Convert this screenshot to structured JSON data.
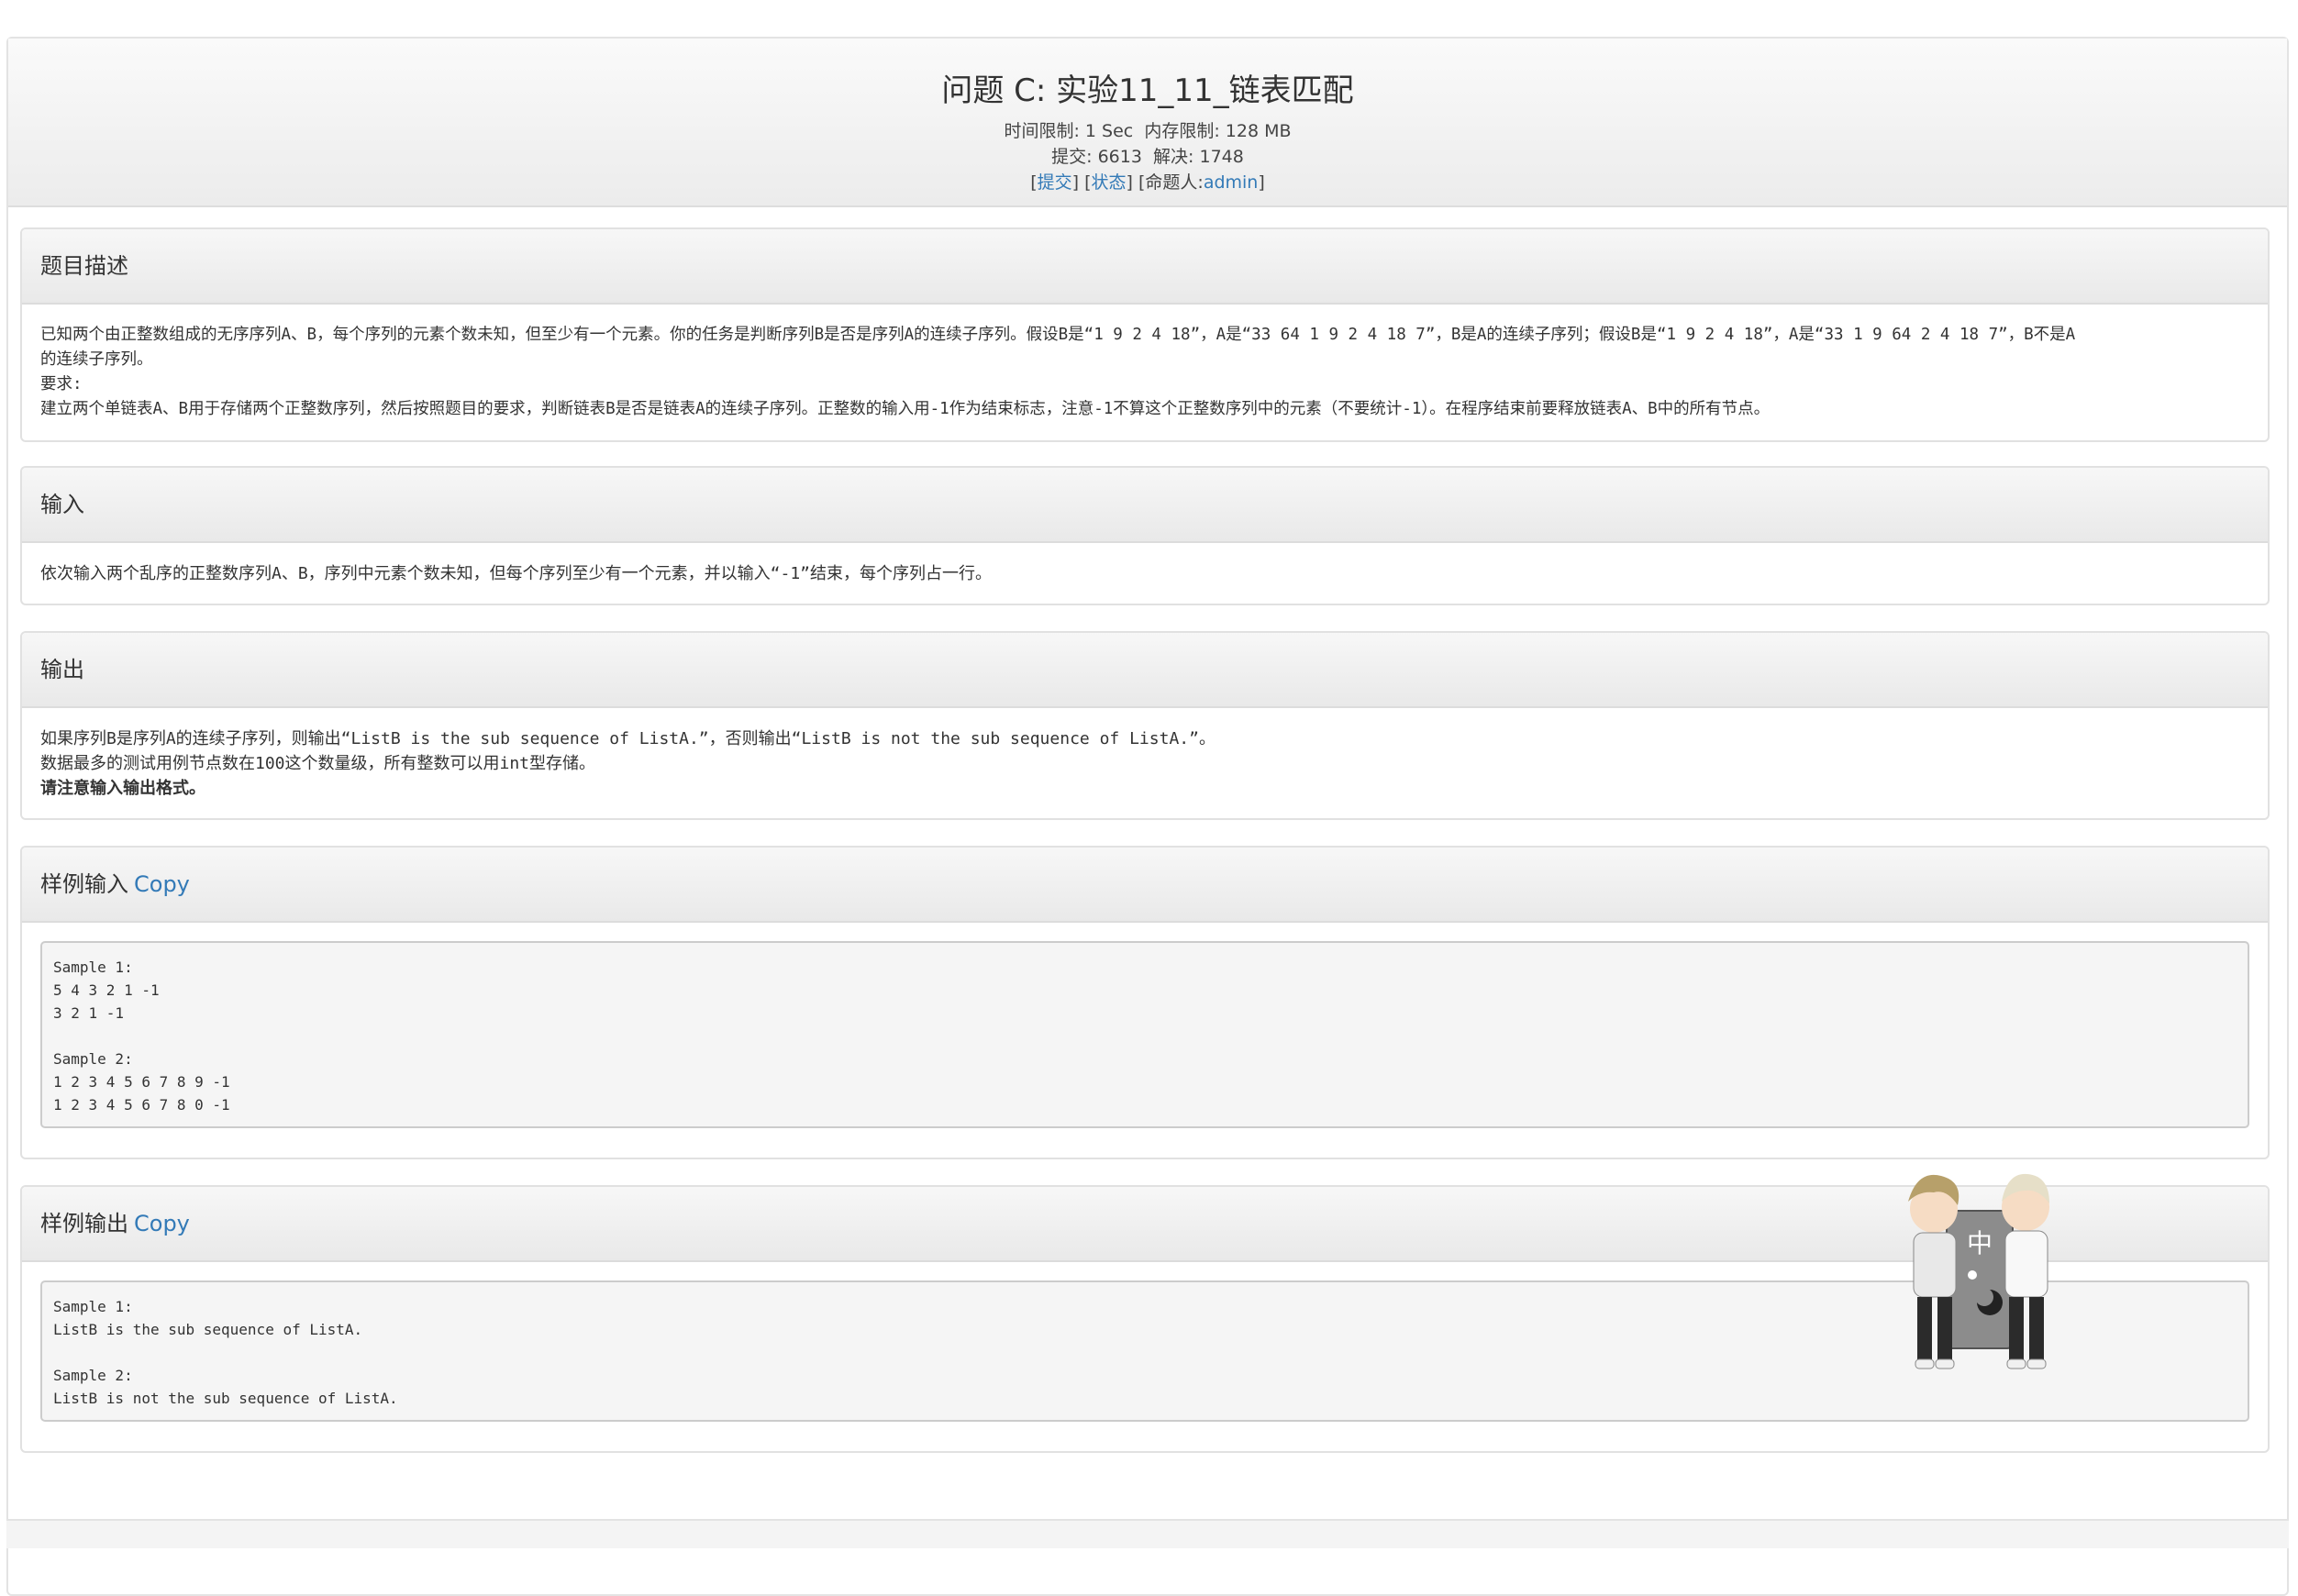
{
  "header": {
    "title": "问题 C: 实验11_11_链表匹配",
    "time_limit_label": "时间限制:",
    "time_limit_value": "1 Sec",
    "memory_limit_label": "内存限制:",
    "memory_limit_value": "128 MB",
    "submit_count_label": "提交:",
    "submit_count_value": "6613",
    "solved_label": "解决:",
    "solved_value": "1748",
    "submit_link": "提交",
    "status_link": "状态",
    "author_label": "命题人:",
    "author_value": "admin"
  },
  "description": {
    "heading": "题目描述",
    "line1": "已知两个由正整数组成的无序序列A、B，每个序列的元素个数未知，但至少有一个元素。你的任务是判断序列B是否是序列A的连续子序列。假设B是“1 9 2 4 18”，A是“33 64 1 9 2 4 18 7”，B是A的连续子序列；假设B是“1 9 2 4 18”，A是“33 1 9 64 2 4 18 7”，B不是A",
    "line2": "的连续子序列。",
    "line3": "要求:",
    "line4": "建立两个单链表A、B用于存储两个正整数序列，然后按照题目的要求，判断链表B是否是链表A的连续子序列。正整数的输入用-1作为结束标志，注意-1不算这个正整数序列中的元素（不要统计-1）。在程序结束前要释放链表A、B中的所有节点。"
  },
  "input": {
    "heading": "输入",
    "text": "依次输入两个乱序的正整数序列A、B，序列中元素个数未知，但每个序列至少有一个元素，并以输入“-1”结束，每个序列占一行。"
  },
  "output": {
    "heading": "输出",
    "line1": "如果序列B是序列A的连续子序列，则输出“ListB is the sub sequence of ListA.”，否则输出“ListB is not the sub sequence of ListA.”。",
    "line2": "数据最多的测试用例节点数在100这个数量级，所有整数可以用int型存储。",
    "line3": "请注意输入输出格式。"
  },
  "sample_input": {
    "heading": "样例输入",
    "copy_label": "Copy",
    "content": "Sample 1:\n5 4 3 2 1 -1\n3 2 1 -1\n\nSample 2:\n1 2 3 4 5 6 7 8 9 -1\n1 2 3 4 5 6 7 8 0 -1"
  },
  "sample_output": {
    "heading": "样例输出",
    "copy_label": "Copy",
    "content": "Sample 1:\nListB is the sub sequence of ListA.\n\nSample 2:\nListB is not the sub sequence of ListA."
  },
  "mascot": {
    "sign_char": "中"
  }
}
